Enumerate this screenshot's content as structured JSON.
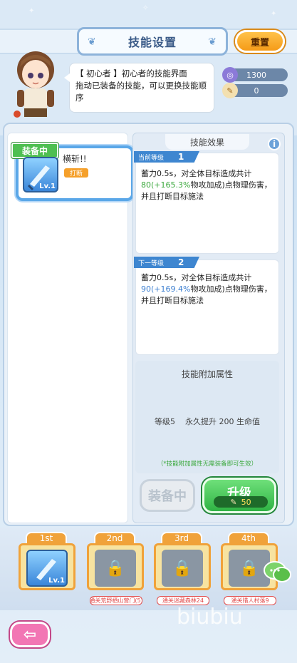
{
  "header": {
    "title": "技能设置",
    "reset_label": "重置"
  },
  "intro": {
    "line1": "【 初心者 】初心者的技能界面",
    "line2": "拖动已装备的技能，可以更换技能顺序"
  },
  "resources": {
    "currency": "1300",
    "scroll": "0"
  },
  "skill_card": {
    "equipped_tag": "装备中",
    "name": "横斩!!",
    "level": "Lv.1",
    "tag": "打断"
  },
  "effect": {
    "heading": "技能效果",
    "current_label": "当前等级",
    "current_level": "1",
    "current_desc_a": "蓄力0.5s，对全体目标造成共计",
    "current_value": "80",
    "current_pct": "(+165.3%",
    "current_desc_b": "物攻加成)点物理伤害，并且打断目标施法",
    "next_label": "下一等级",
    "next_level": "2",
    "next_desc_a": "蓄力0.5s，对全体目标造成共计",
    "next_value": "90",
    "next_pct": "(+169.4%",
    "next_desc_b": "物攻加成)点物理伤害，并且打断目标施法"
  },
  "attribute": {
    "title": "技能附加属性",
    "level_text": "等级5",
    "bonus_text": "永久提升 200 生命值",
    "note": "（*技能附加属性无需装备即可生效）"
  },
  "buttons": {
    "equip": "装备中",
    "upgrade": "升级",
    "upgrade_cost": "50"
  },
  "slots": [
    {
      "tag": "1st",
      "caption": "",
      "level": "Lv.1"
    },
    {
      "tag": "2nd",
      "caption": "通关荒野栖山营门(5)"
    },
    {
      "tag": "3rd",
      "caption": "通关迷藏森林24"
    },
    {
      "tag": "4th",
      "caption": "通关猎人村落9"
    }
  ],
  "watermark": "biubiu",
  "colors": {
    "accent_blue": "#3e86d0",
    "upgrade_green": "#2fb344",
    "reset_orange": "#f59b18",
    "back_pink": "#f276b4"
  }
}
